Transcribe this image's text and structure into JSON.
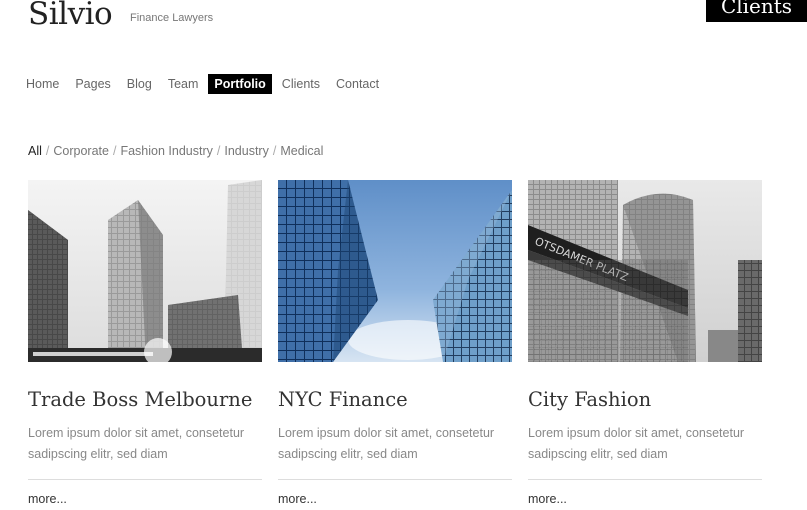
{
  "site": {
    "logo": "Silvio",
    "tagline": "Finance Lawyers",
    "badge": "Clients"
  },
  "nav": [
    {
      "label": "Home",
      "active": false
    },
    {
      "label": "Pages",
      "active": false
    },
    {
      "label": "Blog",
      "active": false
    },
    {
      "label": "Team",
      "active": false
    },
    {
      "label": "Portfolio",
      "active": true
    },
    {
      "label": "Clients",
      "active": false
    },
    {
      "label": "Contact",
      "active": false
    }
  ],
  "filters": {
    "separator": "/",
    "items": [
      "All",
      "Corporate",
      "Fashion Industry",
      "Industry",
      "Medical"
    ]
  },
  "cards": [
    {
      "title": "Trade Boss Melbourne",
      "excerpt": "Lorem ipsum dolor sit amet, consetetur sadipscing elitr, sed diam",
      "more": "more..."
    },
    {
      "title": "NYC Finance",
      "excerpt": "Lorem ipsum dolor sit amet, consetetur sadipscing elitr, sed diam",
      "more": "more..."
    },
    {
      "title": "City Fashion",
      "excerpt": "Lorem ipsum dolor sit amet, consetetur sadipscing elitr, sed diam",
      "more": "more..."
    }
  ],
  "images": {
    "sign_text": "OTSDAMER PLATZ"
  },
  "colors": {
    "nav_active_bg": "#000000",
    "nav_active_text": "#ffffff",
    "sky_blue": "#6f9bd0"
  }
}
